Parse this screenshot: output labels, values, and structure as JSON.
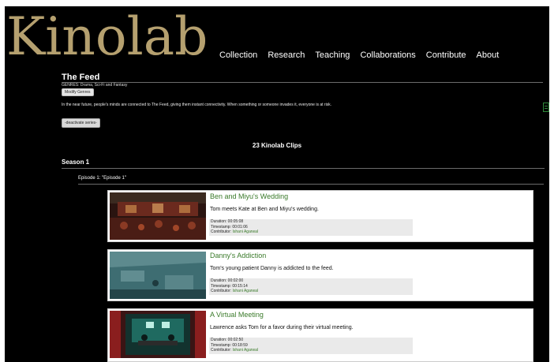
{
  "header": {
    "logo": "Kinolab",
    "nav": [
      "Collection",
      "Research",
      "Teaching",
      "Collaborations",
      "Contribute",
      "About"
    ]
  },
  "series": {
    "title": "The Feed",
    "genres": "GENRES: Drama, Sci-Fi and Fantasy",
    "modify_genres_label": "Modify Genres",
    "description": "In the near future, people's minds are connected to The Feed, giving them instant connectivity. When something or someone invades it, everyone is at risk.",
    "deactivate_label": "-deactivate series-",
    "clip_count": "23 Kinolab Clips"
  },
  "season": {
    "label": "Season 1",
    "episode_label": "Episode 1: \"Episode 1\""
  },
  "clips": [
    {
      "title": "Ben and Miyu's Wedding",
      "description": "Tom meets Kate at Ben and Miyu's wedding.",
      "duration": "Duration: 00:05:08",
      "timestamp": "Timestamp: 00:01:06",
      "contributor_label": "Contributor: ",
      "contributor": "Ishani Agarwal"
    },
    {
      "title": "Danny's Addiction",
      "description": "Tom's young patient Danny is addicted to the feed.",
      "duration": "Duration: 00:02:00",
      "timestamp": "Timestamp: 00:15:14",
      "contributor_label": "Contributor: ",
      "contributor": "Ishani Agarwal"
    },
    {
      "title": "A Virtual Meeting",
      "description": "Lawrence asks Tom for a favor during their virtual meeting.",
      "duration": "Duration: 00:02:50",
      "timestamp": "Timestamp: 00:18:59",
      "contributor_label": "Contributor: ",
      "contributor": "Ishani Agarwal"
    }
  ],
  "colors": {
    "background": "#000000",
    "logo": "#b5a06f",
    "link_green": "#3a7a2a"
  }
}
